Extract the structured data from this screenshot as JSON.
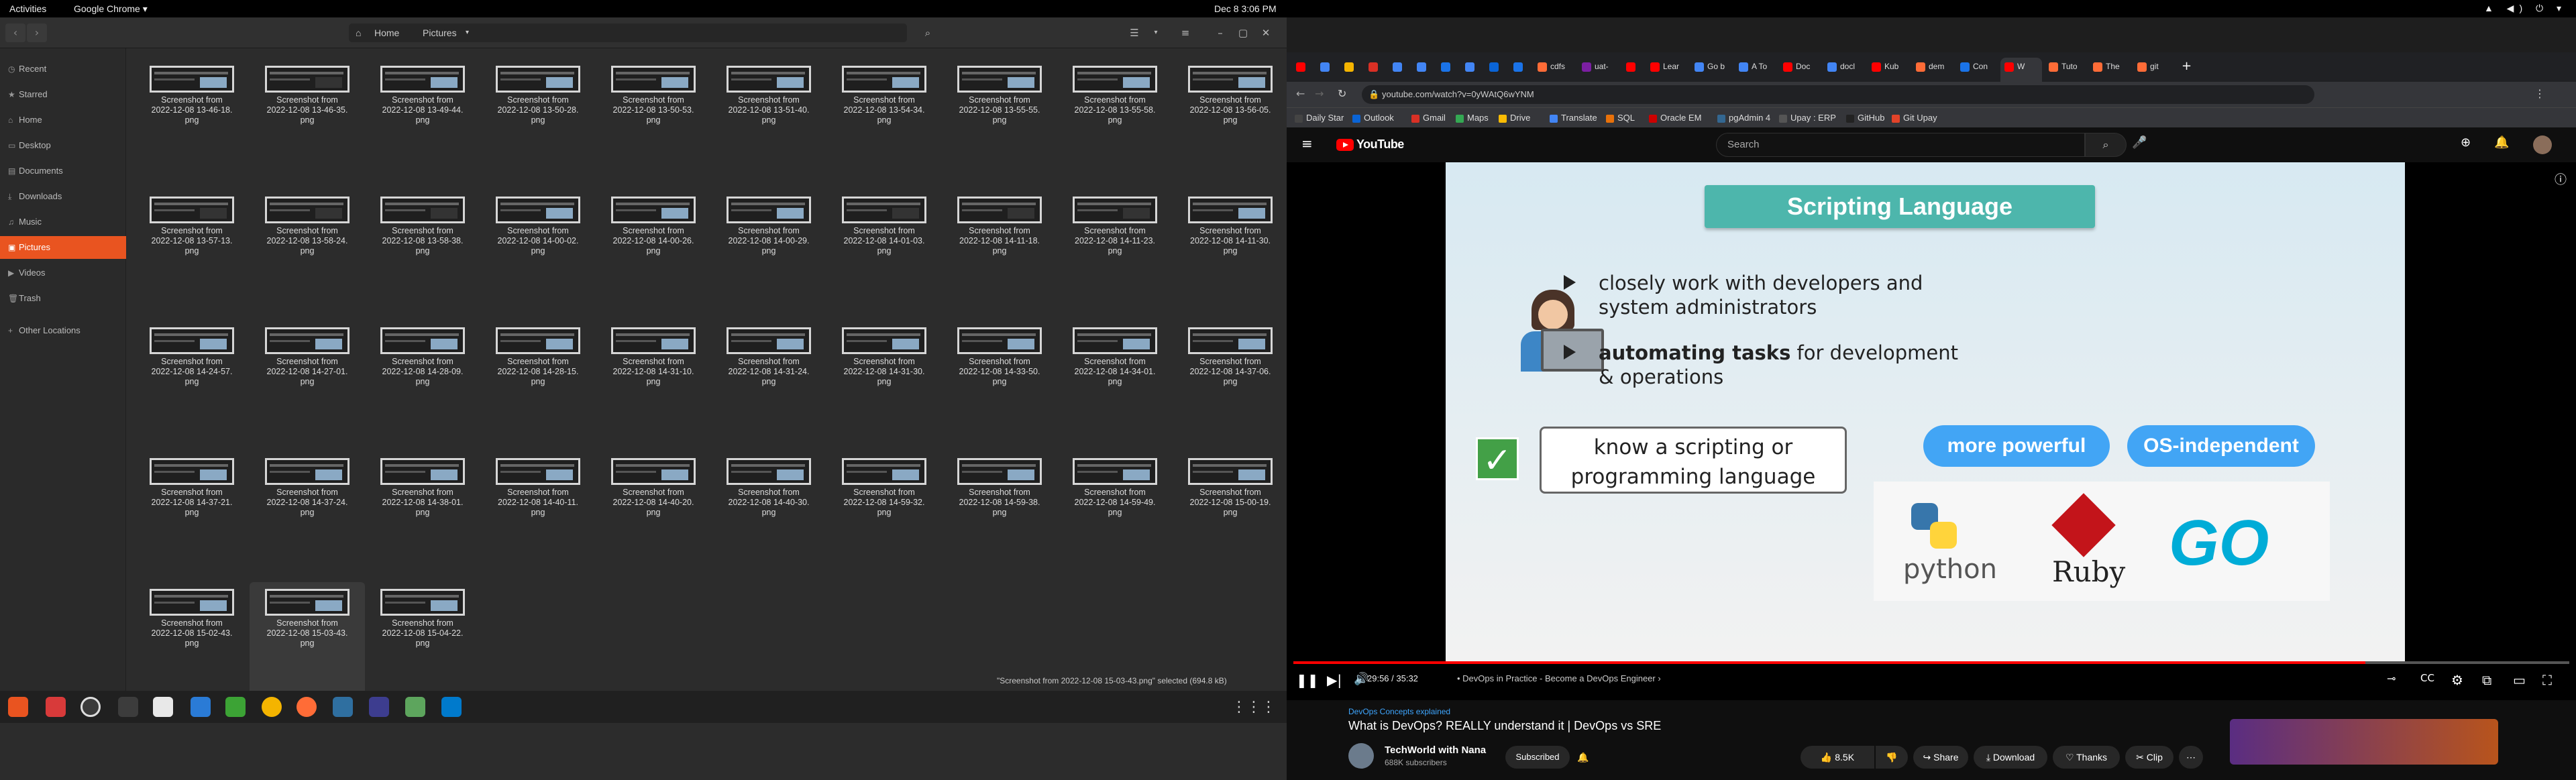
{
  "topbar": {
    "activities": "Activities",
    "app": "Google Chrome ▾",
    "clock": "Dec 8  3:06 PM",
    "sys": "▲ ◀) ⏻ ▾"
  },
  "files": {
    "path_home": "Home",
    "path_pictures": "Pictures",
    "sidebar": [
      {
        "icon": "recent-icon",
        "glyph": "◷",
        "label": "Recent"
      },
      {
        "icon": "star-icon",
        "glyph": "★",
        "label": "Starred"
      },
      {
        "icon": "home-icon",
        "glyph": "⌂",
        "label": "Home"
      },
      {
        "icon": "desktop-icon",
        "glyph": "▭",
        "label": "Desktop"
      },
      {
        "icon": "documents-icon",
        "glyph": "▤",
        "label": "Documents"
      },
      {
        "icon": "downloads-icon",
        "glyph": "⤓",
        "label": "Downloads"
      },
      {
        "icon": "music-icon",
        "glyph": "♫",
        "label": "Music"
      },
      {
        "icon": "pictures-icon",
        "glyph": "▣",
        "label": "Pictures"
      },
      {
        "icon": "videos-icon",
        "glyph": "▶",
        "label": "Videos"
      },
      {
        "icon": "trash-icon",
        "glyph": "🗑",
        "label": "Trash"
      },
      {
        "icon": "plus-icon",
        "glyph": "+",
        "label": "Other Locations"
      }
    ],
    "items": [
      {
        "line1": "Screenshot from",
        "line2": "2022-12-08 13-46-18.",
        "line3": "png"
      },
      {
        "line1": "Screenshot from",
        "line2": "2022-12-08 13-46-35.",
        "line3": "png"
      },
      {
        "line1": "Screenshot from",
        "line2": "2022-12-08 13-49-44.",
        "line3": "png"
      },
      {
        "line1": "Screenshot from",
        "line2": "2022-12-08 13-50-28.",
        "line3": "png"
      },
      {
        "line1": "Screenshot from",
        "line2": "2022-12-08 13-50-53.",
        "line3": "png"
      },
      {
        "line1": "Screenshot from",
        "line2": "2022-12-08 13-51-40.",
        "line3": "png"
      },
      {
        "line1": "Screenshot from",
        "line2": "2022-12-08 13-54-34.",
        "line3": "png"
      },
      {
        "line1": "Screenshot from",
        "line2": "2022-12-08 13-55-55.",
        "line3": "png"
      },
      {
        "line1": "Screenshot from",
        "line2": "2022-12-08 13-55-58.",
        "line3": "png"
      },
      {
        "line1": "Screenshot from",
        "line2": "2022-12-08 13-56-05.",
        "line3": "png"
      },
      {
        "line1": "Screenshot from",
        "line2": "2022-12-08 13-57-13.",
        "line3": "png"
      },
      {
        "line1": "Screenshot from",
        "line2": "2022-12-08 13-58-24.",
        "line3": "png"
      },
      {
        "line1": "Screenshot from",
        "line2": "2022-12-08 13-58-38.",
        "line3": "png"
      },
      {
        "line1": "Screenshot from",
        "line2": "2022-12-08 14-00-02.",
        "line3": "png"
      },
      {
        "line1": "Screenshot from",
        "line2": "2022-12-08 14-00-26.",
        "line3": "png"
      },
      {
        "line1": "Screenshot from",
        "line2": "2022-12-08 14-00-29.",
        "line3": "png"
      },
      {
        "line1": "Screenshot from",
        "line2": "2022-12-08 14-01-03.",
        "line3": "png"
      },
      {
        "line1": "Screenshot from",
        "line2": "2022-12-08 14-11-18.",
        "line3": "png"
      },
      {
        "line1": "Screenshot from",
        "line2": "2022-12-08 14-11-23.",
        "line3": "png"
      },
      {
        "line1": "Screenshot from",
        "line2": "2022-12-08 14-11-30.",
        "line3": "png"
      },
      {
        "line1": "Screenshot from",
        "line2": "2022-12-08 14-24-57.",
        "line3": "png"
      },
      {
        "line1": "Screenshot from",
        "line2": "2022-12-08 14-27-01.",
        "line3": "png"
      },
      {
        "line1": "Screenshot from",
        "line2": "2022-12-08 14-28-09.",
        "line3": "png"
      },
      {
        "line1": "Screenshot from",
        "line2": "2022-12-08 14-28-15.",
        "line3": "png"
      },
      {
        "line1": "Screenshot from",
        "line2": "2022-12-08 14-31-10.",
        "line3": "png"
      },
      {
        "line1": "Screenshot from",
        "line2": "2022-12-08 14-31-24.",
        "line3": "png"
      },
      {
        "line1": "Screenshot from",
        "line2": "2022-12-08 14-31-30.",
        "line3": "png"
      },
      {
        "line1": "Screenshot from",
        "line2": "2022-12-08 14-33-50.",
        "line3": "png"
      },
      {
        "line1": "Screenshot from",
        "line2": "2022-12-08 14-34-01.",
        "line3": "png"
      },
      {
        "line1": "Screenshot from",
        "line2": "2022-12-08 14-37-06.",
        "line3": "png"
      },
      {
        "line1": "Screenshot from",
        "line2": "2022-12-08 14-37-21.",
        "line3": "png"
      },
      {
        "line1": "Screenshot from",
        "line2": "2022-12-08 14-37-24.",
        "line3": "png"
      },
      {
        "line1": "Screenshot from",
        "line2": "2022-12-08 14-38-01.",
        "line3": "png"
      },
      {
        "line1": "Screenshot from",
        "line2": "2022-12-08 14-40-11.",
        "line3": "png"
      },
      {
        "line1": "Screenshot from",
        "line2": "2022-12-08 14-40-20.",
        "line3": "png"
      },
      {
        "line1": "Screenshot from",
        "line2": "2022-12-08 14-40-30.",
        "line3": "png"
      },
      {
        "line1": "Screenshot from",
        "line2": "2022-12-08 14-59-32.",
        "line3": "png"
      },
      {
        "line1": "Screenshot from",
        "line2": "2022-12-08 14-59-38.",
        "line3": "png"
      },
      {
        "line1": "Screenshot from",
        "line2": "2022-12-08 14-59-49.",
        "line3": "png"
      },
      {
        "line1": "Screenshot from",
        "line2": "2022-12-08 15-00-19.",
        "line3": "png"
      },
      {
        "line1": "Screenshot from",
        "line2": "2022-12-08 15-02-43.",
        "line3": "png"
      },
      {
        "line1": "Screenshot from",
        "line2": "2022-12-08 15-03-43.",
        "line3": "png"
      },
      {
        "line1": "Screenshot from",
        "line2": "2022-12-08 15-04-22.",
        "line3": "png"
      }
    ],
    "status": "\"Screenshot from 2022-12-08 15-03-43.png\" selected  (694.8 kB)"
  },
  "dock": {
    "grid_glyph": "⋮⋮⋮"
  },
  "chrome": {
    "tabs": [
      "",
      "",
      "",
      "",
      "",
      "",
      "",
      "",
      "",
      "",
      "cdfs",
      "uat-",
      "",
      "Lear",
      "Go b",
      "A To",
      "Doc",
      "docl",
      "Kub",
      "dem",
      "Con",
      "W",
      "Tuto",
      "The",
      "git"
    ],
    "url": "youtube.com/watch?v=0yWAtQ6wYNM",
    "bookmarks": [
      {
        "label": "Daily Star",
        "color": "#444"
      },
      {
        "label": "Outlook",
        "color": "#0a64d6"
      },
      {
        "label": "Gmail",
        "color": "#d93025"
      },
      {
        "label": "Maps",
        "color": "#34a853"
      },
      {
        "label": "Drive",
        "color": "#fbbc04"
      },
      {
        "label": "Translate",
        "color": "#4285f4"
      },
      {
        "label": "SQL",
        "color": "#e8710a"
      },
      {
        "label": "Oracle EM",
        "color": "#c00"
      },
      {
        "label": "pgAdmin 4",
        "color": "#336791"
      },
      {
        "label": "Upay : ERP",
        "color": "#555"
      },
      {
        "label": "GitHub",
        "color": "#222"
      },
      {
        "label": "Git Upay",
        "color": "#e24329"
      }
    ]
  },
  "youtube": {
    "logo": "YouTube",
    "search_placeholder": "Search",
    "slide": {
      "title": "Scripting Language",
      "bullet1_l1": "closely work with developers and",
      "bullet1_l2": "system administrators",
      "bullet2_bold": "automating tasks",
      "bullet2_rest": " for development",
      "bullet2_l2": "& operations",
      "box_l1": "know a scripting or",
      "box_l2": "programming language",
      "pill1": "more powerful",
      "pill2": "OS-independent",
      "lang1": "python",
      "lang2": "Ruby",
      "lang3": "GO"
    },
    "progress_fraction": 0.84,
    "time": "29:56 / 35:32",
    "chapter": "• DevOps in Practice - Become a DevOps Engineer  ›",
    "video_tag": "DevOps Concepts explained",
    "title": "What is DevOps? REALLY understand it | DevOps vs SRE",
    "channel": "TechWorld with Nana",
    "subscribers": "688K subscribers",
    "subscribed": "Subscribed",
    "likes": "8.5K",
    "share": "Share",
    "download": "Download",
    "thanks": "Thanks",
    "clip": "Clip"
  }
}
